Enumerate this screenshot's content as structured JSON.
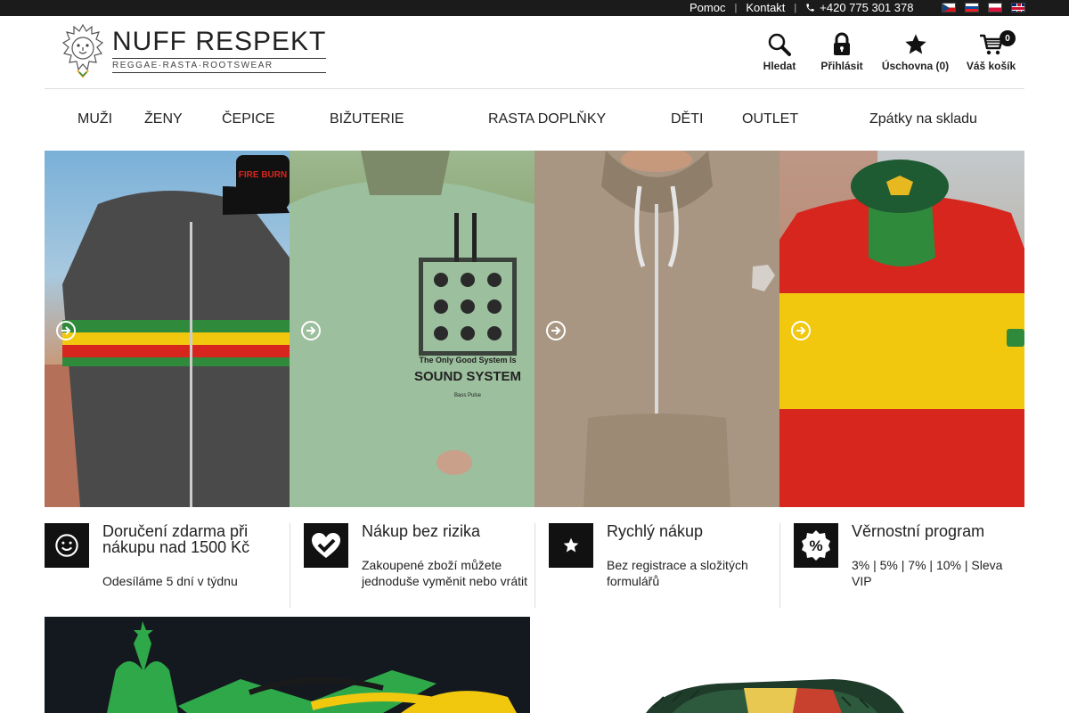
{
  "topbar": {
    "help": "Pomoc",
    "contact": "Kontakt",
    "phone": "+420 775 301 378",
    "flags": [
      "cz",
      "sk",
      "pl",
      "gb"
    ]
  },
  "header": {
    "brand": "NUFF RESPEKT",
    "tagline": "REGGAE·RASTA·ROOTSWEAR",
    "actions": {
      "search": "Hledat",
      "login": "Přihlásit",
      "wishlist": "Úschovna (0)",
      "cart": "Váš košík",
      "cart_count": "0"
    }
  },
  "nav": {
    "items": [
      "MUŽI",
      "ŽENY",
      "ČEPICE",
      "BIŽUTERIE",
      "RASTA DOPLŇKY",
      "DĚTI",
      "OUTLET",
      "Zpátky na skladu"
    ]
  },
  "hero": {
    "tiles": [
      {
        "cap_text": "FIRE BURN"
      },
      {
        "shirt_text": "The Only Good System Is",
        "shirt_big": "SOUND SYSTEM",
        "shirt_small": "Bass Pulse"
      },
      {},
      {}
    ]
  },
  "benefits": [
    {
      "icon": "smiley-icon",
      "title": "Doručení zdarma při nákupu nad 1500 Kč",
      "desc": "Odesíláme 5 dní v týdnu"
    },
    {
      "icon": "check-heart-icon",
      "title": "Nákup bez rizika",
      "desc": "Zakoupené zboží můžete jednoduše vyměnit nebo vrátit"
    },
    {
      "icon": "star-icon",
      "title": "Rychlý nákup",
      "desc": "Bez registrace a složitých formulářů"
    },
    {
      "icon": "percent-icon",
      "title": "Věrnostní program",
      "desc": "3% | 5% | 7% | 10% | Sleva VIP"
    }
  ],
  "colors": {
    "topbar": "#1b1b1b",
    "icon_bg": "#111111",
    "rasta_red": "#d7261e",
    "rasta_yellow": "#f2c80f",
    "rasta_green": "#2f8a3b"
  }
}
